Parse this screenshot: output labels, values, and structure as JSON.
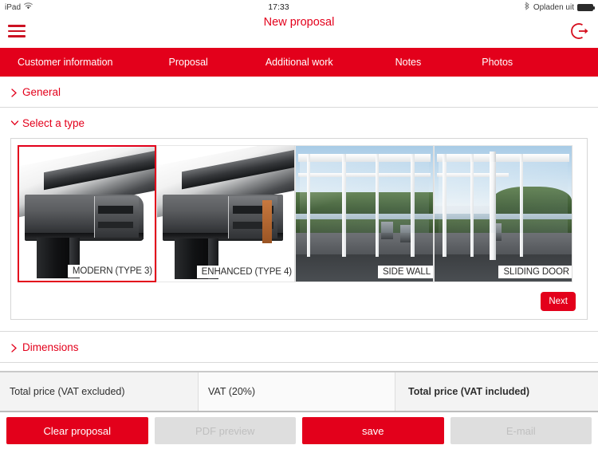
{
  "colors": {
    "brand_red": "#e3001b",
    "tabbar_red": "#e3001b",
    "disabled_gray": "#dedede",
    "text_dark": "#2e2e2e"
  },
  "statusbar": {
    "device": "iPad",
    "wifi_icon": "wifi-icon",
    "time": "17:33",
    "bluetooth_icon": "bluetooth-icon",
    "battery_label": "Opladen uit",
    "battery_icon": "battery-full-icon"
  },
  "header": {
    "menu_icon": "hamburger-menu-icon",
    "title": "New proposal",
    "logout_icon": "logout-icon"
  },
  "tabs": [
    {
      "label": "Customer information",
      "active": false
    },
    {
      "label": "Proposal",
      "active": true
    },
    {
      "label": "Additional work",
      "active": false
    },
    {
      "label": "Notes",
      "active": false
    },
    {
      "label": "Photos",
      "active": false
    }
  ],
  "accordions": [
    {
      "label": "General",
      "expanded": false,
      "chevron": "chevron-right-icon"
    },
    {
      "label": "Select a type",
      "expanded": true,
      "chevron": "chevron-down-icon"
    },
    {
      "label": "Dimensions",
      "expanded": false,
      "chevron": "chevron-right-icon"
    }
  ],
  "type_gallery": {
    "cards": [
      {
        "label": "MODERN (TYPE 3)",
        "selected": true,
        "thumb": "aluminium-profile-modern"
      },
      {
        "label": "ENHANCED (TYPE 4)",
        "selected": false,
        "thumb": "aluminium-profile-enhanced"
      },
      {
        "label": "SIDE WALL",
        "selected": false,
        "thumb": "veranda-side-wall-photo"
      },
      {
        "label": "SLIDING DOOR",
        "selected": false,
        "thumb": "veranda-sliding-door-photo"
      }
    ],
    "next_label": "Next"
  },
  "totals": [
    {
      "label": "Total price (VAT excluded)",
      "value": ""
    },
    {
      "label": "VAT (20%)",
      "value": ""
    },
    {
      "label": "Total price (VAT included)",
      "value": ""
    }
  ],
  "actions": [
    {
      "label": "Clear proposal",
      "enabled": true
    },
    {
      "label": "PDF preview",
      "enabled": false
    },
    {
      "label": "save",
      "enabled": true
    },
    {
      "label": "E-mail",
      "enabled": false
    }
  ]
}
